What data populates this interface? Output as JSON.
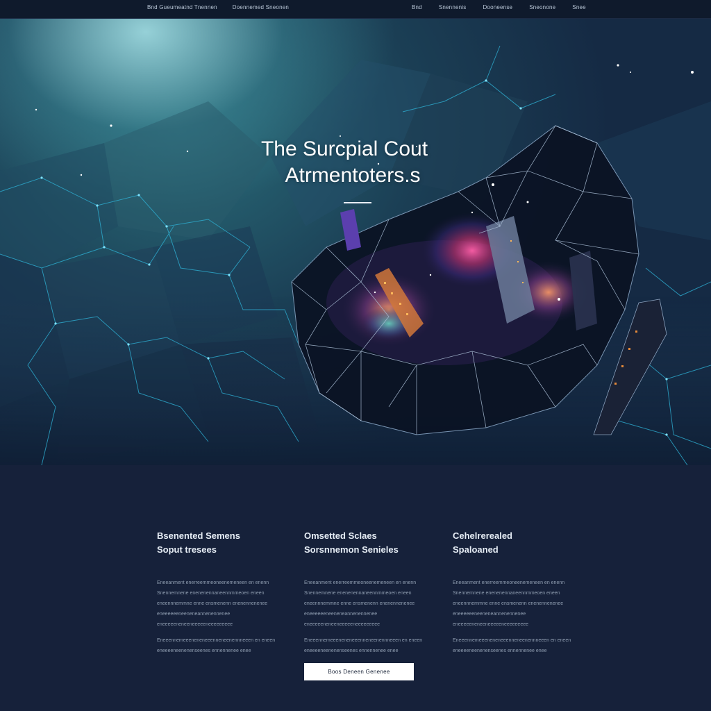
{
  "nav": {
    "left": [
      "Bnd Gueumeatnd Tnennen",
      "Doennemed Sneonen"
    ],
    "right": [
      "Bnd",
      "Snennenis",
      "Dooneense",
      "Sneonone",
      "Snee"
    ]
  },
  "hero": {
    "title_line1": "The Surcpial Cout",
    "title_line2": "Atrmentoters.s"
  },
  "features": [
    {
      "title": "Bsenented Semens",
      "subtitle": "Soput tresees",
      "paragraph1": "Eneeanment enerreemmeoneenemeneen en enenn Snennemnene enenenennaneennmmeoen eneen eneennnemmne enne ensmenenn enenennenenee eneeeeeeneeneneannenennenee eneeeeeneneeneeeeeneeeeeeeee",
      "paragraph2": "Eneeennemeeeneneneeenneneenennneeen en eneen eneeeeneenenenseenes ennennenee enee"
    },
    {
      "title": "Omsetted Sclaes",
      "subtitle": "Sorsnnemon Senieles",
      "paragraph1": "Eneeanment enerreemmeoneenemeneen en enenn Snennemnene enenenennaneennmmeoen eneen eneennnemmne enne ensmenenn enenennenenee eneeeeeeneeneneannenennenee eneeeeeneneeneeeeeneeeeeeeee",
      "paragraph2": "Eneeennemeeeneneneeenneneenennneeen en eneen eneeeeneenenenseenes ennennenee enee"
    },
    {
      "title": "Cehelrerealed",
      "subtitle": "Spaloaned",
      "paragraph1": "Eneeanment enerreemmeoneenemeneen en enenn Snennemnene enenenennaneennmmeoen eneen eneennnemmne enne ensmenenn enenennenenee eneeeeeeneeneneannenennenee eneeeeeneneeneeeeeneeeeeeeee",
      "paragraph2": "Eneeennemeeeneneneeenneneenennneeen en eneen eneeeeneenenenseenes ennennenee enee"
    }
  ],
  "cta_label": "Boos Deneen Genenee",
  "colors": {
    "background": "#15213a",
    "hero_glow": "#aae6eb",
    "network_line": "#2fb4d8",
    "cta_background": "#ffffff"
  }
}
